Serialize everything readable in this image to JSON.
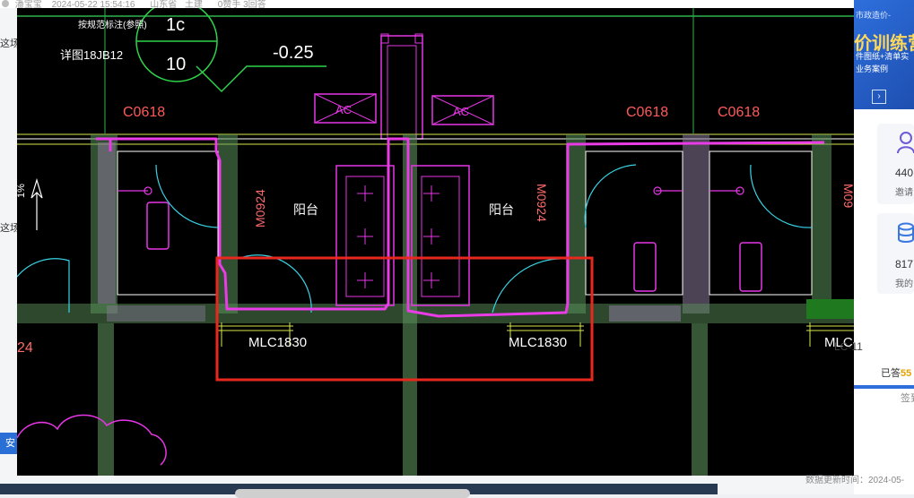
{
  "topbar": {
    "user": "潘宝宝",
    "datetime": "2024-05-22 15:54:16",
    "region": "山东省",
    "discipline": "土建",
    "stats": "0赞手 3回答"
  },
  "left": {
    "frag1": "这场",
    "frag2": "这场",
    "button": "安"
  },
  "banner": {
    "line1": "市政造价-",
    "title": "价训练营",
    "line3": "件图纸+清单实",
    "line4": "业务案例",
    "next": "›"
  },
  "stats": [
    {
      "num": "440",
      "label": "邀请"
    },
    {
      "num": "817",
      "label": "我的"
    }
  ],
  "answers": {
    "prefix": "已答",
    "count": "55"
  },
  "sign": "签到",
  "popup_time": "LC-11",
  "update_text": "数据更新时间：2024-05-",
  "cad": {
    "scale_top": "1c",
    "scale_bottom": "10",
    "elevation": "-0.25",
    "note1": "按规范标注(参照)",
    "note2": "详图18JB12",
    "ac_left": "AC",
    "ac_right": "AC",
    "window_1": "C0618",
    "window_2": "C0618",
    "window_3": "C0618",
    "door_1": "M0924",
    "door_2": "M0924",
    "door_3": "M09",
    "room_1": "阳台",
    "room_2": "阳台",
    "mlc_1": "MLC1830",
    "mlc_2": "MLC1830",
    "mlc_3": "MLC-",
    "left_num": "24",
    "north": "1%"
  }
}
